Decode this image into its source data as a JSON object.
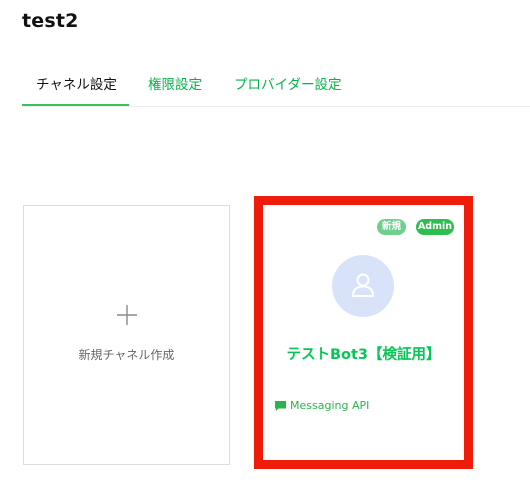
{
  "page": {
    "title": "test2"
  },
  "tabs": [
    {
      "label": "チャネル設定",
      "active": true
    },
    {
      "label": "権限設定",
      "active": false
    },
    {
      "label": "プロバイダー設定",
      "active": false
    }
  ],
  "new_channel_card": {
    "label": "新規チャネル作成",
    "icon": "plus-icon"
  },
  "channel_card": {
    "badges": [
      "新規",
      "Admin"
    ],
    "name": "テストBot3【検証用】",
    "channel_type": "Messaging API",
    "avatar_icon": "user-icon",
    "type_icon": "chat-bubble-icon",
    "highlighted": true
  },
  "colors": {
    "accent": "#06c755",
    "tab_link": "#06b34a",
    "highlight_border": "#ee1c0a",
    "avatar_bg": "#d8e3fa",
    "badge_new": "#6fcf8c",
    "badge_admin": "#2ebd4f"
  }
}
